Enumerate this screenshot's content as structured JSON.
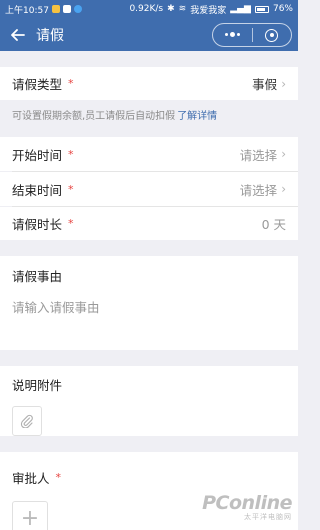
{
  "status_bar": {
    "time": "上午10:57",
    "network_speed": "0.92K/s",
    "carrier": "我爱我家",
    "battery": "76%",
    "battery_level": 0.76
  },
  "nav": {
    "back_icon": "arrow-left-icon",
    "title": "请假",
    "menu_icon": "more-dots-icon",
    "close_icon": "record-circle-icon"
  },
  "form": {
    "leave_type": {
      "label": "请假类型",
      "required": "*",
      "value": "事假"
    },
    "hint": {
      "text": "可设置假期余额,员工请假后自动扣假",
      "link": "了解详情"
    },
    "start_time": {
      "label": "开始时间",
      "required": "*",
      "placeholder": "请选择"
    },
    "end_time": {
      "label": "结束时间",
      "required": "*",
      "placeholder": "请选择"
    },
    "duration": {
      "label": "请假时长",
      "required": "*",
      "value": "0 天"
    },
    "reason": {
      "label": "请假事由",
      "placeholder": "请输入请假事由"
    },
    "attachment": {
      "label": "说明附件",
      "icon": "paperclip-icon"
    },
    "approver": {
      "label": "审批人",
      "required": "*",
      "icon": "plus-icon"
    }
  },
  "watermark": {
    "main": "PConline",
    "sub": "太平洋电脑网"
  },
  "colors": {
    "header": "#3f6dae",
    "required": "#e64340",
    "link": "#3f6dae",
    "background": "#efeff4"
  }
}
